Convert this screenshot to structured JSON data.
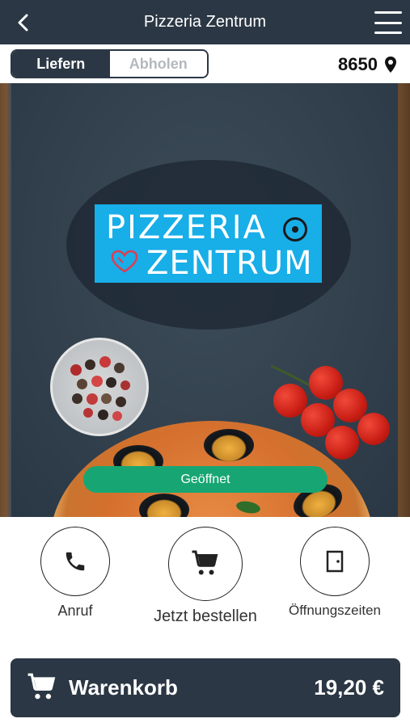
{
  "header": {
    "title": "Pizzeria Zentrum",
    "back_icon": "chevron-left-icon",
    "menu_icon": "hamburger-menu-icon"
  },
  "mode": {
    "options": [
      "Liefern",
      "Abholen"
    ],
    "selected": "Liefern"
  },
  "location": {
    "zip": "8650",
    "icon": "location-pin-icon"
  },
  "hero": {
    "logo_line1": "PIZZERIA",
    "logo_line2": "ZENTRUM",
    "status_text": "Geöffnet",
    "status_color": "#17a673"
  },
  "actions": [
    {
      "label": "Anruf",
      "icon": "phone-icon"
    },
    {
      "label": "Jetzt bestellen",
      "icon": "cart-icon"
    },
    {
      "label": "Öffnungszeiten",
      "icon": "door-icon"
    }
  ],
  "cart": {
    "label": "Warenkorb",
    "total": "19,20 €",
    "icon": "cart-icon"
  },
  "colors": {
    "primary_dark": "#2b3744",
    "logo_blue": "#18aee8",
    "open_green": "#17a673"
  }
}
